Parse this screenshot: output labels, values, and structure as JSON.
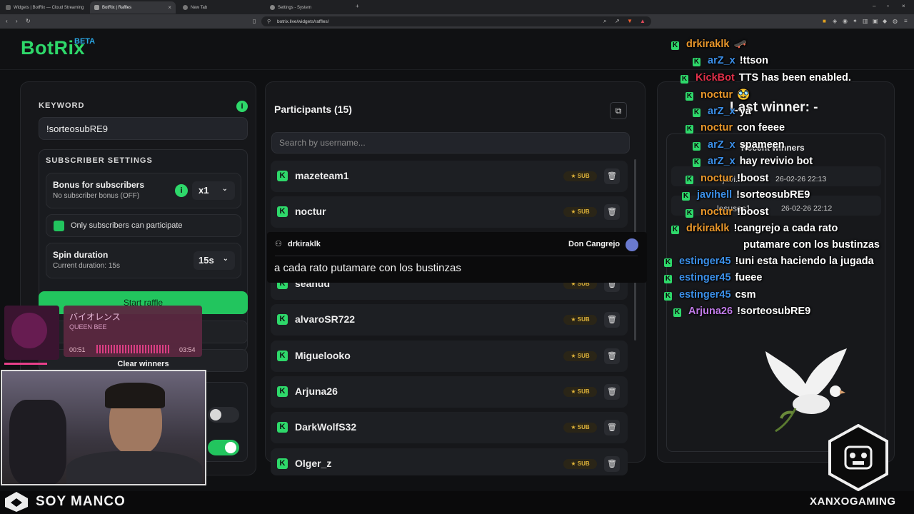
{
  "browser": {
    "tabs": [
      {
        "label": "Widgets | BotRix — Cloud Streaming"
      },
      {
        "label": "BotRix | Raffles"
      },
      {
        "label": "New Tab"
      },
      {
        "label": "Settings - System"
      }
    ],
    "url": "botrix.live/widgets/raffles/"
  },
  "logo": {
    "name": "BotRix",
    "badge": "BETA"
  },
  "left_panel": {
    "keyword_label": "KEYWORD",
    "keyword_value": "!sorteosubRE9",
    "subscriber_settings_label": "SUBSCRIBER SETTINGS",
    "bonus_title": "Bonus for subscribers",
    "bonus_subtitle": "No subscriber bonus (OFF)",
    "bonus_select": "x1",
    "only_subs_label": "Only subscribers can participate",
    "spin_title": "Spin duration",
    "spin_subtitle": "Current duration: 15s",
    "spin_select": "15s",
    "start_button": "Start raffle",
    "clear_button": "Clear winners"
  },
  "participants": {
    "title": "Participants (15)",
    "search_placeholder": "Search by username...",
    "sub_badge": "SUB",
    "rows": [
      {
        "name": "mazeteam1"
      },
      {
        "name": "noctur"
      },
      {
        "name": "seandd"
      },
      {
        "name": "alvaroSR722"
      },
      {
        "name": "Miguelooko"
      },
      {
        "name": "Arjuna26"
      },
      {
        "name": "DarkWolfS32"
      },
      {
        "name": "Olger_z"
      }
    ]
  },
  "tooltip": {
    "user": "drkiraklk",
    "channel": "Don Cangrejo",
    "message": "a cada rato putamare con los bustinzas"
  },
  "right_panel": {
    "last_winner": "Last winner: -",
    "recent_winners": "Recent winners",
    "winners": [
      {
        "name": "javi...",
        "time": "26-02-26 22:13"
      },
      {
        "name": "lesusos1",
        "time": "26-02-26 22:12"
      }
    ]
  },
  "chat": [
    {
      "user": "drkiraklk",
      "color": "#e8962a",
      "msg": "🛹"
    },
    {
      "user": "arZ_x",
      "color": "#3b8fe8",
      "msg": "!ttson"
    },
    {
      "user": "KickBot",
      "color": "#e2304a",
      "msg": "TTS has been enabled."
    },
    {
      "user": "noctur",
      "color": "#e8962a",
      "msg": "🥸"
    },
    {
      "user": "arZ_x",
      "color": "#3b8fe8",
      "msg": "ya"
    },
    {
      "user": "noctur",
      "color": "#e8962a",
      "msg": "con feeee"
    },
    {
      "user": "arZ_x",
      "color": "#3b8fe8",
      "msg": "spameen"
    },
    {
      "user": "arZ_x",
      "color": "#3b8fe8",
      "msg": "hay revivio bot"
    },
    {
      "user": "noctur",
      "color": "#e8962a",
      "msg": "!boost"
    },
    {
      "user": "javihell",
      "color": "#3b8fe8",
      "msg": "!sorteosubRE9"
    },
    {
      "user": "noctur",
      "color": "#e8962a",
      "msg": "!boost"
    },
    {
      "user": "drkiraklk",
      "color": "#e8962a",
      "msg": "!cangrejo a cada rato"
    },
    {
      "user": "",
      "color": "#e8962a",
      "msg": "putamare con los bustinzas"
    },
    {
      "user": "estinger45",
      "color": "#3b8fe8",
      "msg": "!uni esta haciendo la jugada"
    },
    {
      "user": "estinger45",
      "color": "#3b8fe8",
      "msg": "fueee"
    },
    {
      "user": "estinger45",
      "color": "#3b8fe8",
      "msg": "csm"
    },
    {
      "user": "Arjuna26",
      "color": "#c07ae8",
      "msg": "!sorteosubRE9"
    }
  ],
  "music": {
    "title": "バイオレンス",
    "artist": "QUEEN BEE",
    "elapsed": "00:51",
    "total": "03:54"
  },
  "streamer": {
    "name": "SOY MANCO",
    "brand": "XANXOGAMING"
  },
  "colors": {
    "accent": "#2ed86a",
    "beta": "#2aa8e6",
    "sub_gold": "#e0b43a"
  }
}
